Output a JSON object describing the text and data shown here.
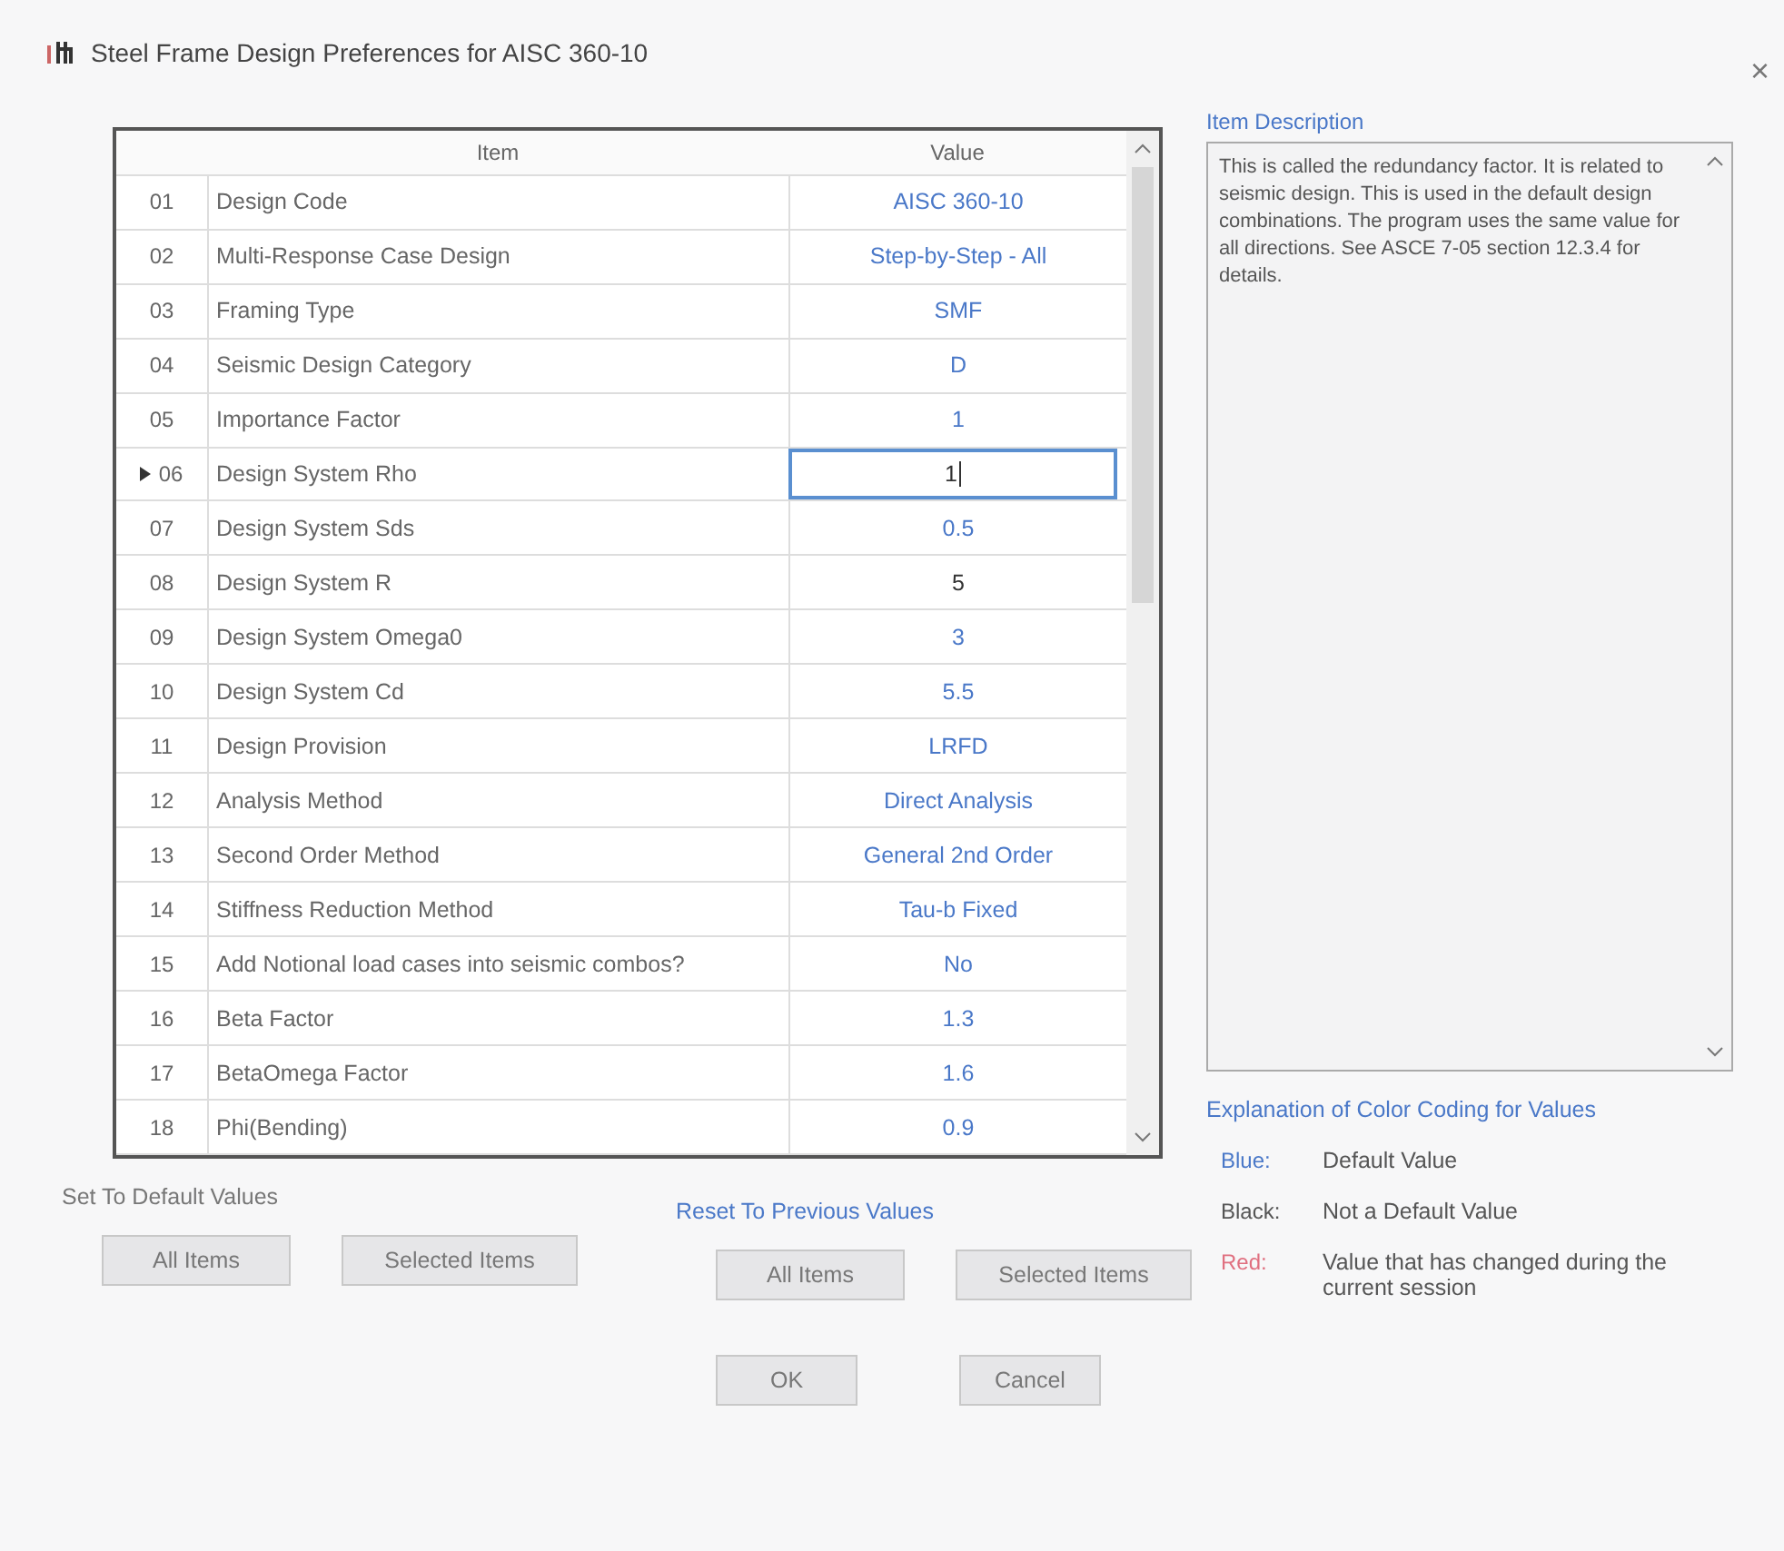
{
  "window": {
    "title": "Steel Frame Design Preferences for AISC 360-10",
    "close": "×"
  },
  "table": {
    "columns": [
      "Item",
      "Value"
    ],
    "rows": [
      {
        "number": "01",
        "item": "Design Code",
        "value": "AISC 360-10",
        "color": "#4a78c8",
        "selected": false,
        "editing": false
      },
      {
        "number": "02",
        "item": "Multi-Response Case Design",
        "value": "Step-by-Step - All",
        "color": "#4a78c8",
        "selected": false,
        "editing": false
      },
      {
        "number": "03",
        "item": "Framing Type",
        "value": "SMF",
        "color": "#4a78c8",
        "selected": false,
        "editing": false
      },
      {
        "number": "04",
        "item": "Seismic Design Category",
        "value": "D",
        "color": "#4a78c8",
        "selected": false,
        "editing": false
      },
      {
        "number": "05",
        "item": "Importance Factor",
        "value": "1",
        "color": "#4a78c8",
        "selected": false,
        "editing": false
      },
      {
        "number": "06",
        "item": "Design System Rho",
        "value": "1",
        "color": "#333333",
        "selected": true,
        "editing": true
      },
      {
        "number": "07",
        "item": "Design System Sds",
        "value": "0.5",
        "color": "#4a78c8",
        "selected": false,
        "editing": false
      },
      {
        "number": "08",
        "item": "Design System R",
        "value": "5",
        "color": "#333333",
        "selected": false,
        "editing": false
      },
      {
        "number": "09",
        "item": "Design System Omega0",
        "value": "3",
        "color": "#4a78c8",
        "selected": false,
        "editing": false
      },
      {
        "number": "10",
        "item": "Design System Cd",
        "value": "5.5",
        "color": "#4a78c8",
        "selected": false,
        "editing": false
      },
      {
        "number": "11",
        "item": "Design Provision",
        "value": "LRFD",
        "color": "#4a78c8",
        "selected": false,
        "editing": false
      },
      {
        "number": "12",
        "item": "Analysis Method",
        "value": "Direct Analysis",
        "color": "#4a78c8",
        "selected": false,
        "editing": false
      },
      {
        "number": "13",
        "item": "Second Order Method",
        "value": "General 2nd Order",
        "color": "#4a78c8",
        "selected": false,
        "editing": false
      },
      {
        "number": "14",
        "item": "Stiffness Reduction Method",
        "value": "Tau-b Fixed",
        "color": "#4a78c8",
        "selected": false,
        "editing": false
      },
      {
        "number": "15",
        "item": "Add Notional load cases into seismic combos?",
        "value": "No",
        "color": "#4a78c8",
        "selected": false,
        "editing": false
      },
      {
        "number": "16",
        "item": "Beta Factor",
        "value": "1.3",
        "color": "#4a78c8",
        "selected": false,
        "editing": false
      },
      {
        "number": "17",
        "item": "BetaOmega Factor",
        "value": "1.6",
        "color": "#4a78c8",
        "selected": false,
        "editing": false
      },
      {
        "number": "18",
        "item": "Phi(Bending)",
        "value": "0.9",
        "color": "#4a78c8",
        "selected": false,
        "editing": false
      }
    ]
  },
  "description": {
    "title": "Item Description",
    "text": "This is called the redundancy factor. It is related to seismic design. This is used in the default design combinations. The program uses the same value for all directions. See ASCE 7-05 section 12.3.4 for details."
  },
  "legend": {
    "title": "Explanation of Color Coding for Values",
    "entries": [
      {
        "label": "Blue:",
        "meaning": "Default Value",
        "color": "#4a78c8"
      },
      {
        "label": "Black:",
        "meaning": "Not a Default Value",
        "color": "#555555"
      },
      {
        "label": "Red:",
        "meaning": "Value that has changed during the current session",
        "color": "#e07080"
      }
    ]
  },
  "default_group": {
    "title": "Set To Default Values",
    "buttons": [
      "All Items",
      "Selected Items"
    ]
  },
  "reset_group": {
    "title": "Reset To Previous Values",
    "buttons": [
      "All Items",
      "Selected Items"
    ]
  },
  "buttons": [
    "OK",
    "Cancel"
  ]
}
